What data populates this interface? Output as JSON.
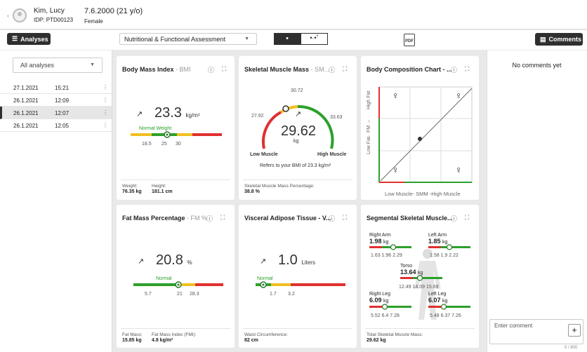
{
  "patient": {
    "name": "Kim, Lucy",
    "idp": "IDP: PTD00123",
    "dob_age": "7.6.2000 (21 y/o)",
    "sex": "Female"
  },
  "toolbar": {
    "analyses_label": "Analyses",
    "assessment_type": "Nutritional & Functional Assessment",
    "comments_label": "Comments",
    "pdf_label": "PDF"
  },
  "sidebar": {
    "filter": "All analyses",
    "rows": [
      {
        "date": "27.1.2021",
        "time": "15:21"
      },
      {
        "date": "26.1.2021",
        "time": "12:09"
      },
      {
        "date": "26.1.2021",
        "time": "12:07"
      },
      {
        "date": "26.1.2021",
        "time": "12:05"
      }
    ]
  },
  "cards": {
    "bmi": {
      "title": "Body Mass Index",
      "title_sub": " - BMI",
      "value": "23.3",
      "unit": "kg/m²",
      "category": "Normal Weight",
      "ticks": [
        "18.5",
        "25",
        "30"
      ],
      "weight_label": "Weight:",
      "weight": "76.35 kg",
      "height_label": "Height:",
      "height": "181.1 cm"
    },
    "smm": {
      "title": "Skeletal Muscle Mass",
      "title_sub": " - SM...",
      "value": "29.62",
      "unit": "kg",
      "top": "30.72",
      "left": "27.92",
      "right": "33.63",
      "low": "Low Muscle",
      "high": "High Muscle",
      "note": "Refers to your BMI of 23.3 kg/m²",
      "foot_label": "Skeletal Muscle Mass Percentage:",
      "foot_value": "38.8 %"
    },
    "bcc": {
      "title": "Body Composition Chart - ...",
      "y_high": "High Fat",
      "y_mid": "← FM →",
      "y_low": "Low Fat",
      "x_axis": "Low Muscle- SMM -High Muscle"
    },
    "fat": {
      "title": "Fat Mass Percentage",
      "title_sub": " - FM %",
      "value": "20.8",
      "unit": "%",
      "category": "Normal",
      "ticks": [
        "5.7",
        "21",
        "28.3"
      ],
      "fm_label": "Fat Mass:",
      "fm_value": "15.85 kg",
      "fmi_label": "Fat Mass Index (FMI):",
      "fmi_value": "4.8 kg/m²"
    },
    "vat": {
      "title": "Visceral Adipose Tissue - V...",
      "value": "1.0",
      "unit": "Liters",
      "category": "Normal",
      "ticks": [
        "1.7",
        "3.2"
      ],
      "foot_label": "Waist Circumference:",
      "foot_value": "82 cm"
    },
    "seg": {
      "title": "Segmental Skeletal Muscle...",
      "right_arm": "Right Arm",
      "right_arm_v": "1.98",
      "right_arm_ticks": [
        "1.63",
        "1.96",
        "2.29"
      ],
      "left_arm": "Left Arm",
      "left_arm_v": "1.85",
      "left_arm_ticks": [
        "1.58",
        "1.9",
        "2.22"
      ],
      "torso": "Torso",
      "torso_v": "13.64",
      "torso_ticks": [
        "12.49",
        "14.09",
        "15.69"
      ],
      "right_leg": "Right Leg",
      "right_leg_v": "6.09",
      "right_leg_ticks": [
        "5.52",
        "6.4",
        "7.28"
      ],
      "left_leg": "Left Leg",
      "left_leg_v": "6.07",
      "left_leg_ticks": [
        "5.48",
        "6.37",
        "7.26"
      ],
      "unit": "kg",
      "foot_label": "Total Skeletal Muscle Mass:",
      "foot_value": "29.62 kg"
    }
  },
  "comments": {
    "empty": "No comments yet",
    "placeholder": "Enter comment",
    "count": "0 / 800"
  }
}
